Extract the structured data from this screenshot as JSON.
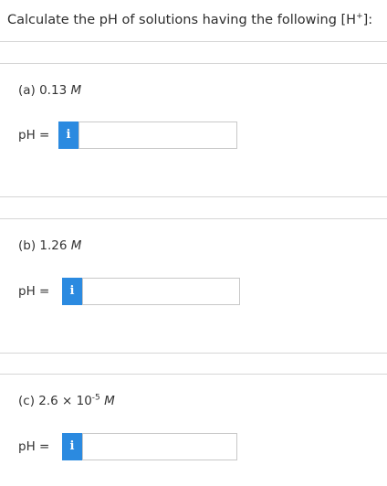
{
  "question": {
    "text_before": "Calculate the pH of solutions having the following [H",
    "superscript": "+",
    "text_after": "]:"
  },
  "parts": [
    {
      "label_prefix": "(a) 0.13 ",
      "unit": "M",
      "ph_label": "pH =",
      "info_icon": "i",
      "input_value": ""
    },
    {
      "label_prefix": "(b) 1.26 ",
      "unit": "M",
      "ph_label": "pH =",
      "info_icon": "i",
      "input_value": ""
    },
    {
      "label_prefix": "(c) 2.6 × 10",
      "exponent": "-5",
      "label_suffix": " ",
      "unit": "M",
      "ph_label": "pH =",
      "info_icon": "i",
      "input_value": ""
    }
  ],
  "colors": {
    "info_button": "#2b8ae0",
    "divider": "#d6d6d6",
    "input_border": "#c8c8c8"
  }
}
